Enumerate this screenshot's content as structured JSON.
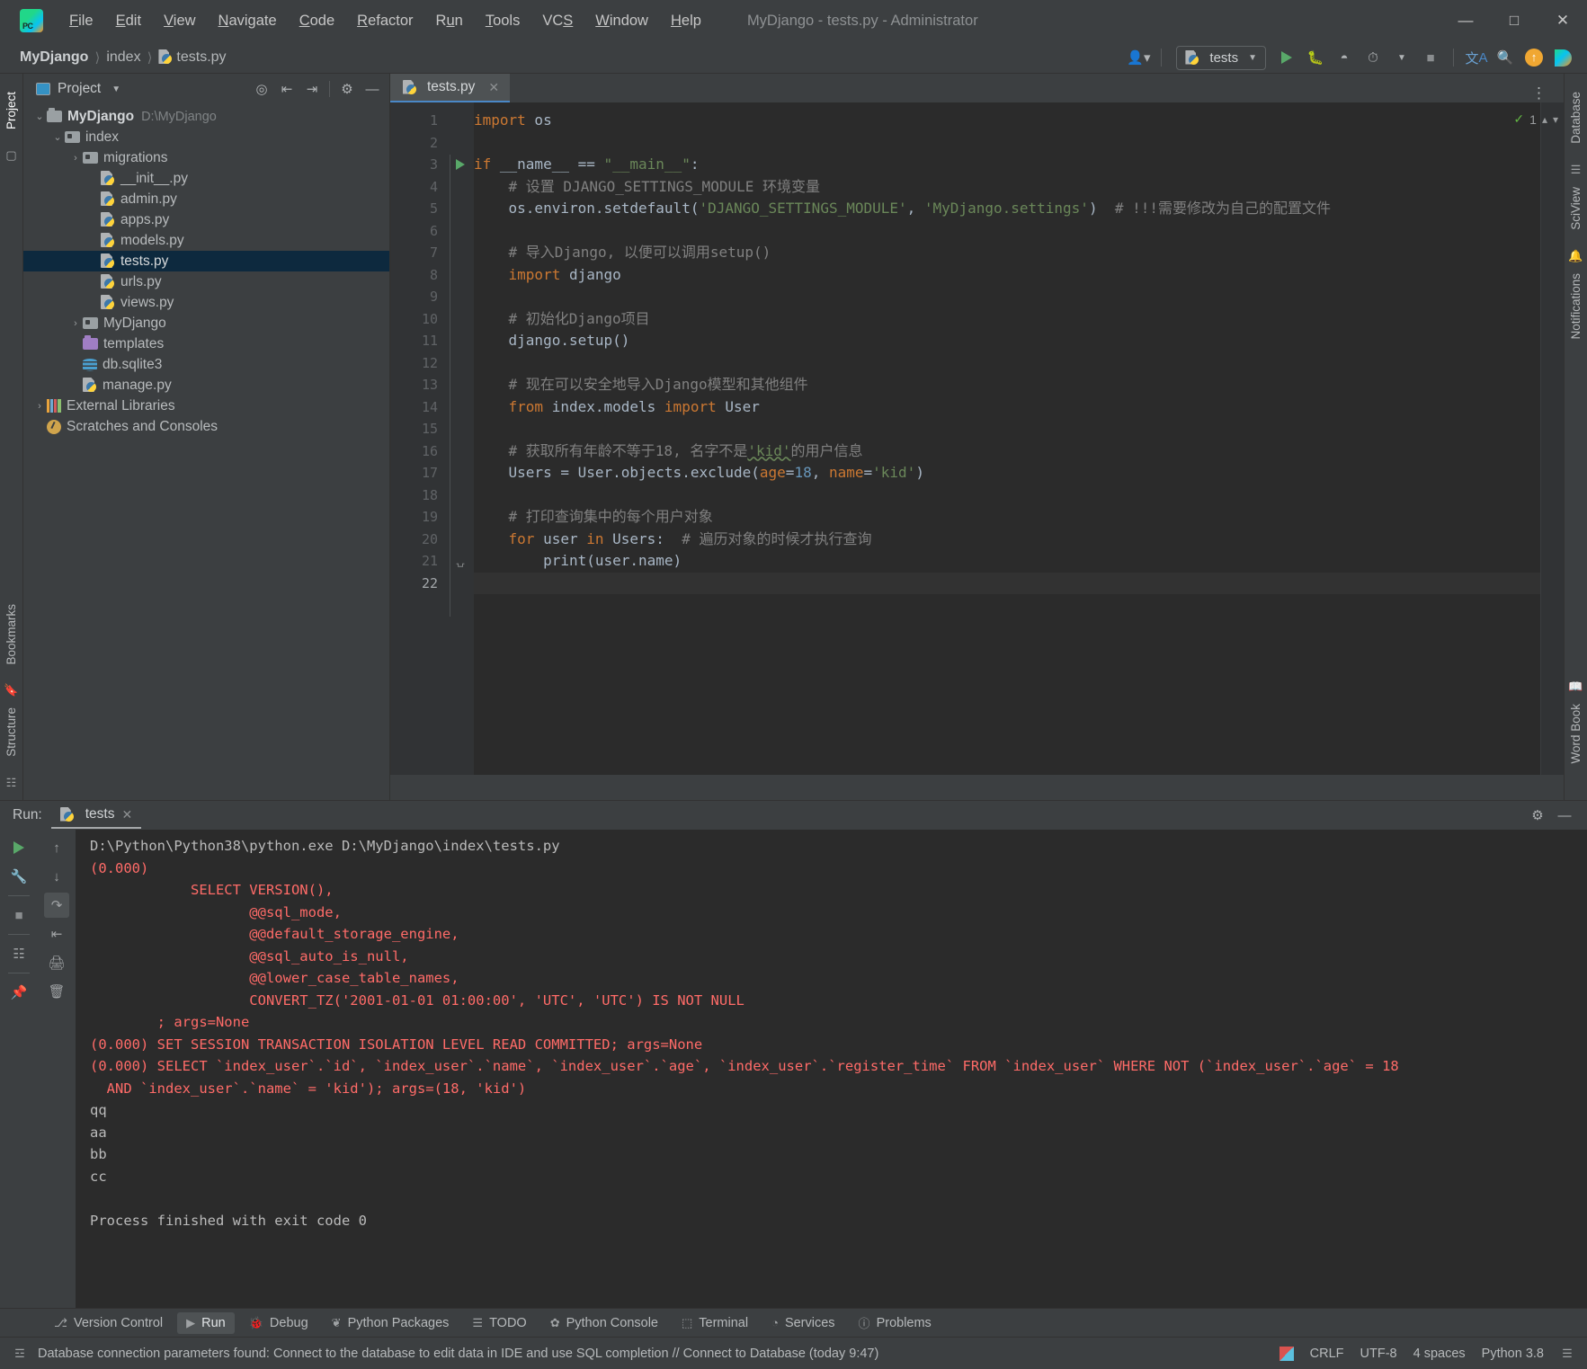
{
  "window": {
    "title": "MyDjango - tests.py - Administrator",
    "app_icon": "pycharm-logo",
    "minimize": "—",
    "maximize": "□",
    "close": "✕"
  },
  "menu": [
    {
      "label": "File",
      "mnemonic": "F"
    },
    {
      "label": "Edit",
      "mnemonic": "E"
    },
    {
      "label": "View",
      "mnemonic": "V"
    },
    {
      "label": "Navigate",
      "mnemonic": "N"
    },
    {
      "label": "Code",
      "mnemonic": "C"
    },
    {
      "label": "Refactor",
      "mnemonic": "R"
    },
    {
      "label": "Run",
      "mnemonic": "u"
    },
    {
      "label": "Tools",
      "mnemonic": "T"
    },
    {
      "label": "VCS",
      "mnemonic": "S"
    },
    {
      "label": "Window",
      "mnemonic": "W"
    },
    {
      "label": "Help",
      "mnemonic": "H"
    }
  ],
  "breadcrumb": {
    "items": [
      "MyDjango",
      "index",
      "tests.py"
    ],
    "separator": "〉"
  },
  "toolbar": {
    "run_config": "tests",
    "icons": [
      "user-accounts-icon",
      "run-icon",
      "debug-icon",
      "run-with-coverage-icon",
      "profile-icon",
      "stop-icon",
      "translate-icon",
      "search-everywhere-icon",
      "update-project-icon",
      "ide-features-icon"
    ]
  },
  "left_strip": {
    "tabs": [
      "Project"
    ],
    "bottom_tabs": [
      "Bookmarks",
      "Structure"
    ]
  },
  "right_strip": {
    "tabs": [
      "Database",
      "SciView",
      "Notifications",
      "Word Book"
    ]
  },
  "project_panel": {
    "title": "Project",
    "actions": [
      "locate-icon",
      "expand-all-icon",
      "collapse-all-icon",
      "settings-gear-icon",
      "hide-icon"
    ],
    "tree": [
      {
        "label": "MyDjango",
        "path": "D:\\MyDjango",
        "indent": 0,
        "arrow": "v",
        "icon": "folder-root",
        "bold": true,
        "selected": false
      },
      {
        "label": "index",
        "path": "",
        "indent": 1,
        "arrow": "v",
        "icon": "folder-module",
        "bold": false,
        "selected": false
      },
      {
        "label": "migrations",
        "path": "",
        "indent": 2,
        "arrow": ">",
        "icon": "folder-module",
        "bold": false,
        "selected": false
      },
      {
        "label": "__init__.py",
        "path": "",
        "indent": 3,
        "arrow": "",
        "icon": "python-file",
        "bold": false,
        "selected": false
      },
      {
        "label": "admin.py",
        "path": "",
        "indent": 3,
        "arrow": "",
        "icon": "python-file",
        "bold": false,
        "selected": false
      },
      {
        "label": "apps.py",
        "path": "",
        "indent": 3,
        "arrow": "",
        "icon": "python-file",
        "bold": false,
        "selected": false
      },
      {
        "label": "models.py",
        "path": "",
        "indent": 3,
        "arrow": "",
        "icon": "python-file",
        "bold": false,
        "selected": false
      },
      {
        "label": "tests.py",
        "path": "",
        "indent": 3,
        "arrow": "",
        "icon": "python-file",
        "bold": false,
        "selected": true
      },
      {
        "label": "urls.py",
        "path": "",
        "indent": 3,
        "arrow": "",
        "icon": "python-file",
        "bold": false,
        "selected": false
      },
      {
        "label": "views.py",
        "path": "",
        "indent": 3,
        "arrow": "",
        "icon": "python-file",
        "bold": false,
        "selected": false
      },
      {
        "label": "MyDjango",
        "path": "",
        "indent": 2,
        "arrow": ">",
        "icon": "folder-module",
        "bold": false,
        "selected": false
      },
      {
        "label": "templates",
        "path": "",
        "indent": 2,
        "arrow": "",
        "icon": "folder-purple",
        "bold": false,
        "selected": false
      },
      {
        "label": "db.sqlite3",
        "path": "",
        "indent": 2,
        "arrow": "",
        "icon": "database-file",
        "bold": false,
        "selected": false
      },
      {
        "label": "manage.py",
        "path": "",
        "indent": 2,
        "arrow": "",
        "icon": "python-file",
        "bold": false,
        "selected": false
      },
      {
        "label": "External Libraries",
        "path": "",
        "indent": 0,
        "arrow": ">",
        "icon": "libraries",
        "bold": false,
        "selected": false
      },
      {
        "label": "Scratches and Consoles",
        "path": "",
        "indent": 0,
        "arrow": "",
        "icon": "scratch",
        "bold": false,
        "selected": false
      }
    ]
  },
  "editor": {
    "tab": {
      "label": "tests.py",
      "icon": "python-file",
      "close": "✕"
    },
    "inspection": {
      "check": "✓",
      "count": "1"
    },
    "total_lines": 22,
    "current_line": 22,
    "lines": [
      {
        "n": 1,
        "tokens": [
          {
            "t": "import",
            "c": "kw"
          },
          {
            "t": " os",
            "c": "pl"
          }
        ],
        "gutter": ""
      },
      {
        "n": 2,
        "tokens": [],
        "gutter": ""
      },
      {
        "n": 3,
        "tokens": [
          {
            "t": "if",
            "c": "kw"
          },
          {
            "t": " __name__ ",
            "c": "pl"
          },
          {
            "t": "==",
            "c": "pl"
          },
          {
            "t": " ",
            "c": "pl"
          },
          {
            "t": "\"__main__\"",
            "c": "str"
          },
          {
            "t": ":",
            "c": "pl"
          }
        ],
        "gutter": "run"
      },
      {
        "n": 4,
        "tokens": [
          {
            "t": "    # 设置 DJANGO_SETTINGS_MODULE 环境变量",
            "c": "cmt"
          }
        ],
        "gutter": ""
      },
      {
        "n": 5,
        "tokens": [
          {
            "t": "    os.environ.setdefault(",
            "c": "pl"
          },
          {
            "t": "'DJANGO_SETTINGS_MODULE'",
            "c": "str"
          },
          {
            "t": ", ",
            "c": "pl"
          },
          {
            "t": "'MyDjango.settings'",
            "c": "str"
          },
          {
            "t": ")  ",
            "c": "pl"
          },
          {
            "t": "# !!!需要修改为自己的配置文件",
            "c": "cmt"
          }
        ],
        "gutter": ""
      },
      {
        "n": 6,
        "tokens": [],
        "gutter": ""
      },
      {
        "n": 7,
        "tokens": [
          {
            "t": "    # 导入Django, 以便可以调用setup()",
            "c": "cmt"
          }
        ],
        "gutter": ""
      },
      {
        "n": 8,
        "tokens": [
          {
            "t": "    ",
            "c": "pl"
          },
          {
            "t": "import",
            "c": "kw"
          },
          {
            "t": " django",
            "c": "pl"
          }
        ],
        "gutter": ""
      },
      {
        "n": 9,
        "tokens": [],
        "gutter": ""
      },
      {
        "n": 10,
        "tokens": [
          {
            "t": "    # 初始化Django项目",
            "c": "cmt"
          }
        ],
        "gutter": ""
      },
      {
        "n": 11,
        "tokens": [
          {
            "t": "    django.setup()",
            "c": "pl"
          }
        ],
        "gutter": ""
      },
      {
        "n": 12,
        "tokens": [],
        "gutter": ""
      },
      {
        "n": 13,
        "tokens": [
          {
            "t": "    # 现在可以安全地导入Django模型和其他组件",
            "c": "cmt"
          }
        ],
        "gutter": ""
      },
      {
        "n": 14,
        "tokens": [
          {
            "t": "    ",
            "c": "pl"
          },
          {
            "t": "from",
            "c": "kw"
          },
          {
            "t": " index.models ",
            "c": "pl"
          },
          {
            "t": "import",
            "c": "kw"
          },
          {
            "t": " User",
            "c": "pl"
          }
        ],
        "gutter": ""
      },
      {
        "n": 15,
        "tokens": [],
        "gutter": ""
      },
      {
        "n": 16,
        "tokens": [
          {
            "t": "    # 获取所有年龄不等于18, 名字不是",
            "c": "cmt"
          },
          {
            "t": "'kid'",
            "c": "str typo"
          },
          {
            "t": "的用户信息",
            "c": "cmt"
          }
        ],
        "gutter": ""
      },
      {
        "n": 17,
        "tokens": [
          {
            "t": "    Users = User.objects.exclude(",
            "c": "pl"
          },
          {
            "t": "age",
            "c": "param"
          },
          {
            "t": "=",
            "c": "pl"
          },
          {
            "t": "18",
            "c": "num"
          },
          {
            "t": ", ",
            "c": "pl"
          },
          {
            "t": "name",
            "c": "param"
          },
          {
            "t": "=",
            "c": "pl"
          },
          {
            "t": "'kid'",
            "c": "str"
          },
          {
            "t": ")",
            "c": "pl"
          }
        ],
        "gutter": ""
      },
      {
        "n": 18,
        "tokens": [],
        "gutter": ""
      },
      {
        "n": 19,
        "tokens": [
          {
            "t": "    # 打印查询集中的每个用户对象",
            "c": "cmt"
          }
        ],
        "gutter": ""
      },
      {
        "n": 20,
        "tokens": [
          {
            "t": "    ",
            "c": "pl"
          },
          {
            "t": "for",
            "c": "kw"
          },
          {
            "t": " user ",
            "c": "pl"
          },
          {
            "t": "in",
            "c": "kw"
          },
          {
            "t": " Users:  ",
            "c": "pl"
          },
          {
            "t": "# 遍历对象的时候才执行查询",
            "c": "cmt"
          }
        ],
        "gutter": ""
      },
      {
        "n": 21,
        "tokens": [
          {
            "t": "        print(user.name)",
            "c": "pl"
          }
        ],
        "gutter": "fold"
      },
      {
        "n": 22,
        "tokens": [],
        "gutter": ""
      }
    ]
  },
  "run_panel": {
    "label": "Run:",
    "tab": "tests",
    "tab_close": "✕",
    "tools_left": [
      "rerun-icon",
      "settings-wrench-icon",
      "stop-icon",
      "layout-icon",
      "pin-icon"
    ],
    "tools_right": [
      "scroll-up-icon",
      "scroll-down-icon",
      "soft-wrap-icon",
      "scroll-to-end-icon",
      "print-icon",
      "clear-all-icon"
    ],
    "header_actions": [
      "settings-gear-icon",
      "hide-icon"
    ],
    "console": [
      {
        "text": "D:\\Python\\Python38\\python.exe D:\\MyDjango\\index\\tests.py",
        "color": "white"
      },
      {
        "text": "(0.000)",
        "color": "red"
      },
      {
        "text": "            SELECT VERSION(),",
        "color": "red"
      },
      {
        "text": "                   @@sql_mode,",
        "color": "red"
      },
      {
        "text": "                   @@default_storage_engine,",
        "color": "red"
      },
      {
        "text": "                   @@sql_auto_is_null,",
        "color": "red"
      },
      {
        "text": "                   @@lower_case_table_names,",
        "color": "red"
      },
      {
        "text": "                   CONVERT_TZ('2001-01-01 01:00:00', 'UTC', 'UTC') IS NOT NULL",
        "color": "red"
      },
      {
        "text": "        ; args=None",
        "color": "red"
      },
      {
        "text": "(0.000) SET SESSION TRANSACTION ISOLATION LEVEL READ COMMITTED; args=None",
        "color": "red"
      },
      {
        "text": "(0.000) SELECT `index_user`.`id`, `index_user`.`name`, `index_user`.`age`, `index_user`.`register_time` FROM `index_user` WHERE NOT (`index_user`.`age` = 18",
        "color": "red"
      },
      {
        "text": "  AND `index_user`.`name` = 'kid'); args=(18, 'kid')",
        "color": "red"
      },
      {
        "text": "qq",
        "color": "white"
      },
      {
        "text": "aa",
        "color": "white"
      },
      {
        "text": "bb",
        "color": "white"
      },
      {
        "text": "cc",
        "color": "white"
      },
      {
        "text": "",
        "color": "white"
      },
      {
        "text": "Process finished with exit code 0",
        "color": "white"
      }
    ]
  },
  "bottom_tabs": [
    {
      "label": "Version Control",
      "icon": "branch-icon",
      "selected": false
    },
    {
      "label": "Run",
      "icon": "run-icon",
      "selected": true
    },
    {
      "label": "Debug",
      "icon": "debug-icon",
      "selected": false
    },
    {
      "label": "Python Packages",
      "icon": "package-icon",
      "selected": false
    },
    {
      "label": "TODO",
      "icon": "todo-icon",
      "selected": false
    },
    {
      "label": "Python Console",
      "icon": "console-icon",
      "selected": false
    },
    {
      "label": "Terminal",
      "icon": "terminal-icon",
      "selected": false
    },
    {
      "label": "Services",
      "icon": "services-icon",
      "selected": false
    },
    {
      "label": "Problems",
      "icon": "problems-icon",
      "selected": false
    }
  ],
  "statusbar": {
    "message": "Database connection parameters found: Connect to the database to edit data in IDE and use SQL completion // Connect to Database (today 9:47)",
    "line_separator": "CRLF",
    "encoding": "UTF-8",
    "indent": "4 spaces",
    "interpreter": "Python 3.8"
  },
  "colors": {
    "accent": "#4a88c7",
    "selection": "#0d293e",
    "editor_bg": "#2b2b2b",
    "panel_bg": "#3c3f41",
    "error_red": "#ff6b68",
    "green": "#59a869"
  }
}
